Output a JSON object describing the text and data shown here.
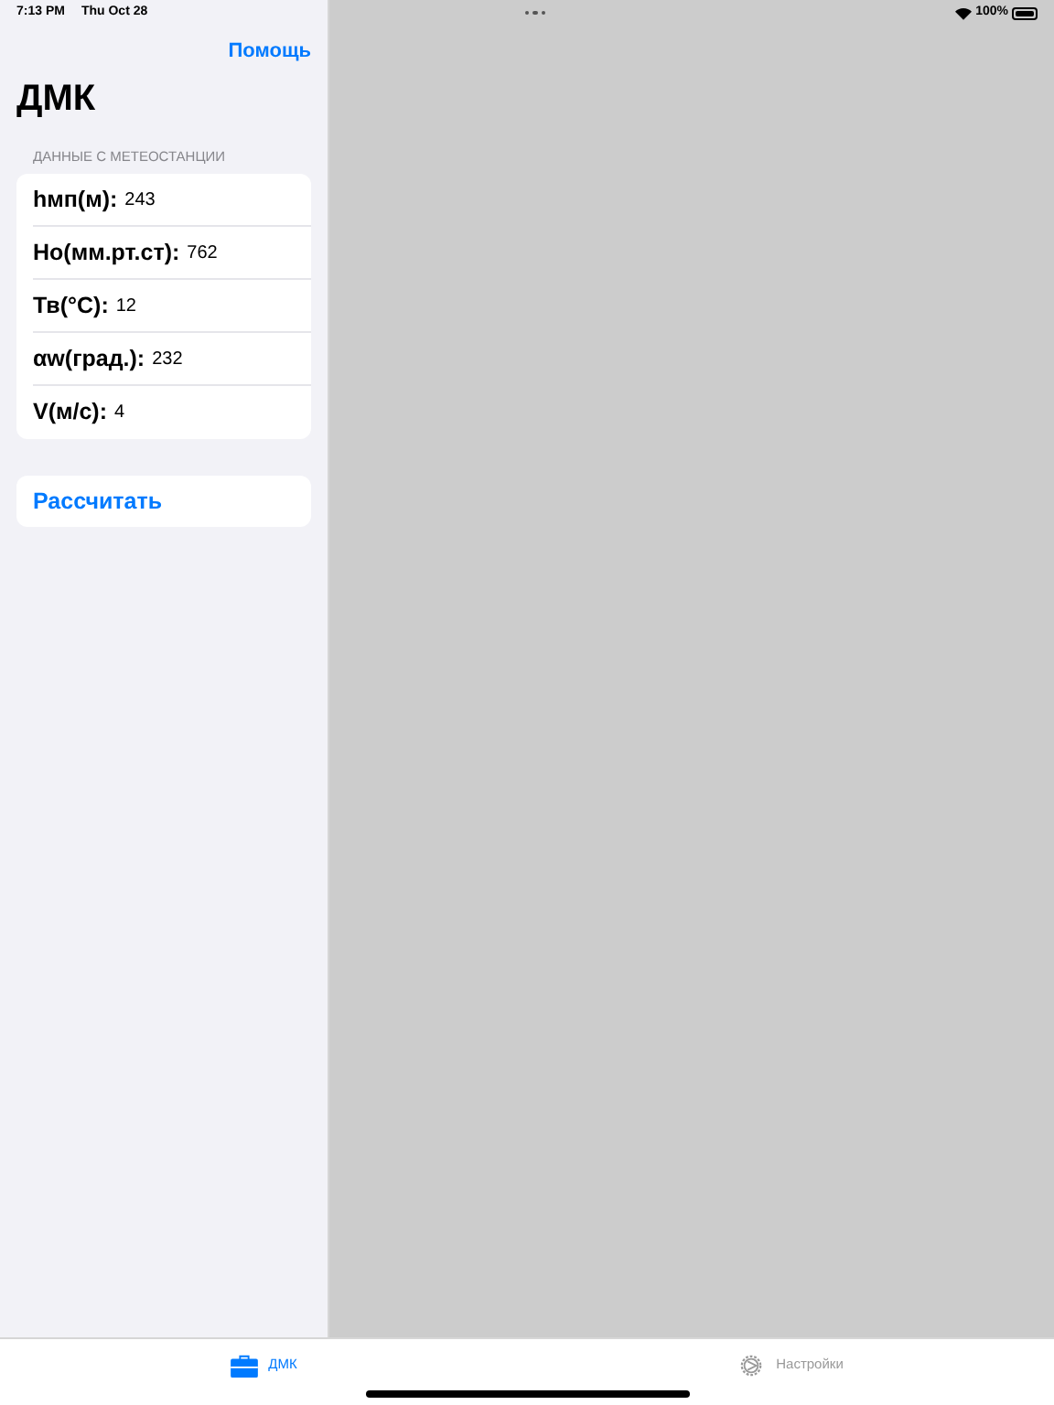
{
  "status_bar": {
    "time": "7:13 PM",
    "date": "Thu Oct 28",
    "battery": "100%"
  },
  "nav": {
    "help_button": "Помощь",
    "title": "ДМК"
  },
  "section_header": "ДАННЫЕ С МЕТЕОСТАНЦИИ",
  "fields": [
    {
      "label": "hмп(м):",
      "value": "243"
    },
    {
      "label": "Ho(мм.рт.ст):",
      "value": "762"
    },
    {
      "label": "Тв(°C):",
      "value": "12"
    },
    {
      "label": "αw(град.):",
      "value": "232"
    },
    {
      "label": "V(м/с):",
      "value": "4"
    }
  ],
  "calculate_button": "Рассчитать",
  "tabs": [
    {
      "label": "ДМК",
      "selected": true,
      "kind": "toolbox"
    },
    {
      "label": "Настройки",
      "selected": false,
      "kind": "gear"
    }
  ]
}
